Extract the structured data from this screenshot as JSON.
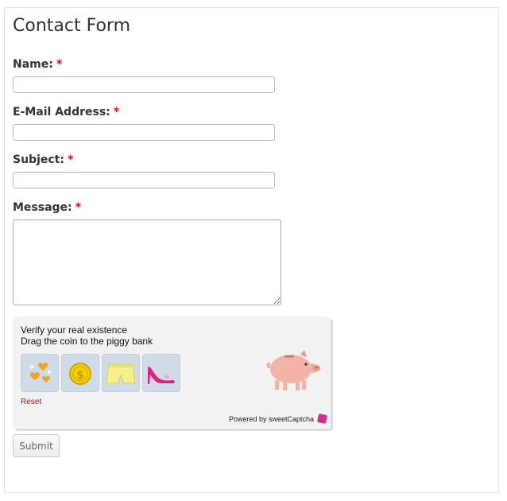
{
  "form": {
    "title": "Contact Form",
    "required_mark": "*",
    "name_label": "Name:",
    "email_label": "E-Mail Address:",
    "subject_label": "Subject:",
    "message_label": "Message:",
    "name_value": "",
    "email_value": "",
    "subject_value": "",
    "message_value": "",
    "submit_label": "Submit"
  },
  "captcha": {
    "line1": "Verify your real existence",
    "line2": "Drag the coin to the piggy bank",
    "reset_label": "Reset",
    "powered_by": "Powered by sweetCaptcha",
    "items": [
      "hearts-icon",
      "coin-icon",
      "shorts-icon",
      "high-heel-icon"
    ],
    "target_icon": "piggy-bank-icon"
  },
  "colors": {
    "required": "#dd1111",
    "captcha_bg": "#f2f2f2",
    "tile_bg": "#cfdbe7",
    "reset_link": "#8a1a1a",
    "brand": "#c8328a"
  }
}
